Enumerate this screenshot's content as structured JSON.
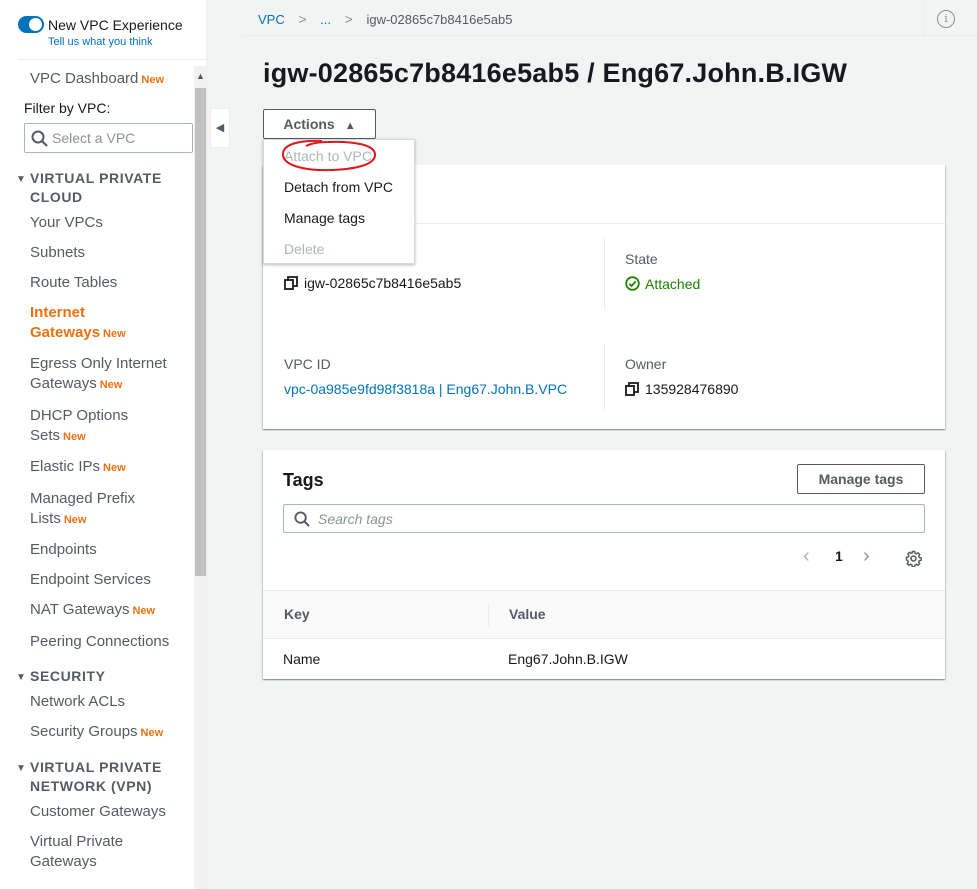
{
  "sidebar": {
    "vpc_experience_label": "New VPC Experience",
    "vpc_experience_link": "Tell us what you think",
    "dashboard_label": "VPC Dashboard",
    "new_badge": "New",
    "filter_label": "Filter by VPC:",
    "filter_placeholder": "Select a VPC",
    "sections": {
      "vpc": "VIRTUAL PRIVATE CLOUD",
      "security": "SECURITY",
      "vpn": "VIRTUAL PRIVATE NETWORK (VPN)"
    },
    "items": {
      "your_vpcs": "Your VPCs",
      "subnets": "Subnets",
      "route_tables": "Route Tables",
      "internet_gateways": "Internet Gateways",
      "egress_only": "Egress Only Internet Gateways",
      "dhcp": "DHCP Options Sets",
      "elastic_ips": "Elastic IPs",
      "prefix_lists": "Managed Prefix Lists",
      "endpoints": "Endpoints",
      "endpoint_services": "Endpoint Services",
      "nat_gateways": "NAT Gateways",
      "peering": "Peering Connections",
      "network_acls": "Network ACLs",
      "security_groups": "Security Groups",
      "customer_gateways": "Customer Gateways",
      "virtual_private_gateways": "Virtual Private Gateways"
    }
  },
  "breadcrumb": {
    "root": "VPC",
    "ellipsis": "...",
    "current": "igw-02865c7b8416e5ab5"
  },
  "header": {
    "title": "igw-02865c7b8416e5ab5 / Eng67.John.B.IGW",
    "actions_label": "Actions",
    "info_icon_text": "i"
  },
  "actions_menu": {
    "attach": "Attach to VPC",
    "detach": "Detach from VPC",
    "manage_tags": "Manage tags",
    "delete": "Delete"
  },
  "details": {
    "igw_id_value": "igw-02865c7b8416e5ab5",
    "state_label": "State",
    "state_value": "Attached",
    "vpc_id_label": "VPC ID",
    "vpc_id_value": "vpc-0a985e9fd98f3818a | Eng67.John.B.VPC",
    "owner_label": "Owner",
    "owner_value": "135928476890"
  },
  "tags": {
    "title": "Tags",
    "manage_button": "Manage tags",
    "search_placeholder": "Search tags",
    "page_number": "1",
    "columns": [
      "Key",
      "Value"
    ],
    "rows": [
      {
        "key": "Name",
        "value": "Eng67.John.B.IGW"
      }
    ]
  },
  "colors": {
    "accent_blue": "#0073bb",
    "active_orange": "#ec7211",
    "success_green": "#1d8102",
    "annotation_red": "#e0161e"
  },
  "icons": [
    "toggle-switch",
    "search-icon",
    "chevron-left-icon",
    "chevron-right-icon",
    "info-icon",
    "caret-up-icon",
    "copy-icon",
    "check-circle-icon",
    "gear-icon",
    "triangle-down-icon"
  ]
}
